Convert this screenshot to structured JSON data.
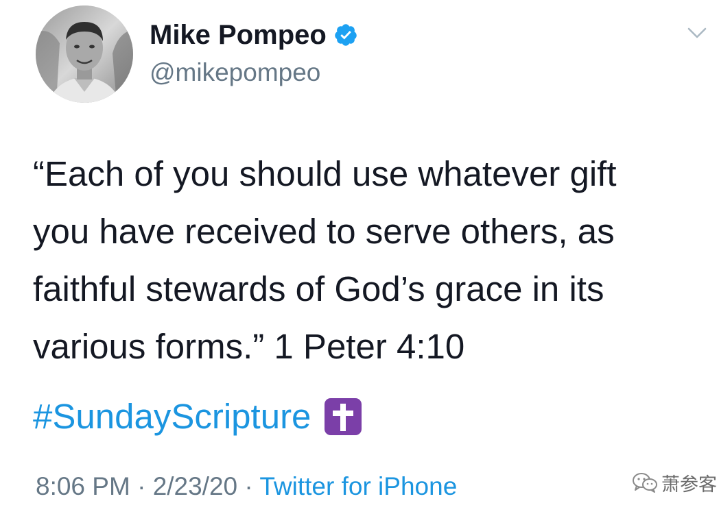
{
  "tweet": {
    "author": {
      "display_name": "Mike Pompeo",
      "handle": "@mikepompeo",
      "verified": true,
      "avatar_icon": "profile-photo"
    },
    "menu_icon": "chevron-down-icon",
    "text_lines": [
      "“Each of you should use whatever gift",
      "you have received to serve others, as",
      "faithful stewards of God’s grace in its",
      "various forms.” 1 Peter 4:10"
    ],
    "hashtag": "#SundayScripture",
    "emoji": "latin-cross-emoji",
    "meta": {
      "time": "8:06 PM",
      "separator": " · ",
      "date": "2/23/20",
      "source": "Twitter for iPhone"
    }
  },
  "watermark": {
    "icon": "wechat-icon",
    "text": "萧参客"
  },
  "colors": {
    "link": "#1b95e0",
    "secondary_text": "#657786",
    "primary_text": "#141823",
    "verified_badge": "#1da1f2",
    "emoji_bg": "#7b3fa8"
  }
}
